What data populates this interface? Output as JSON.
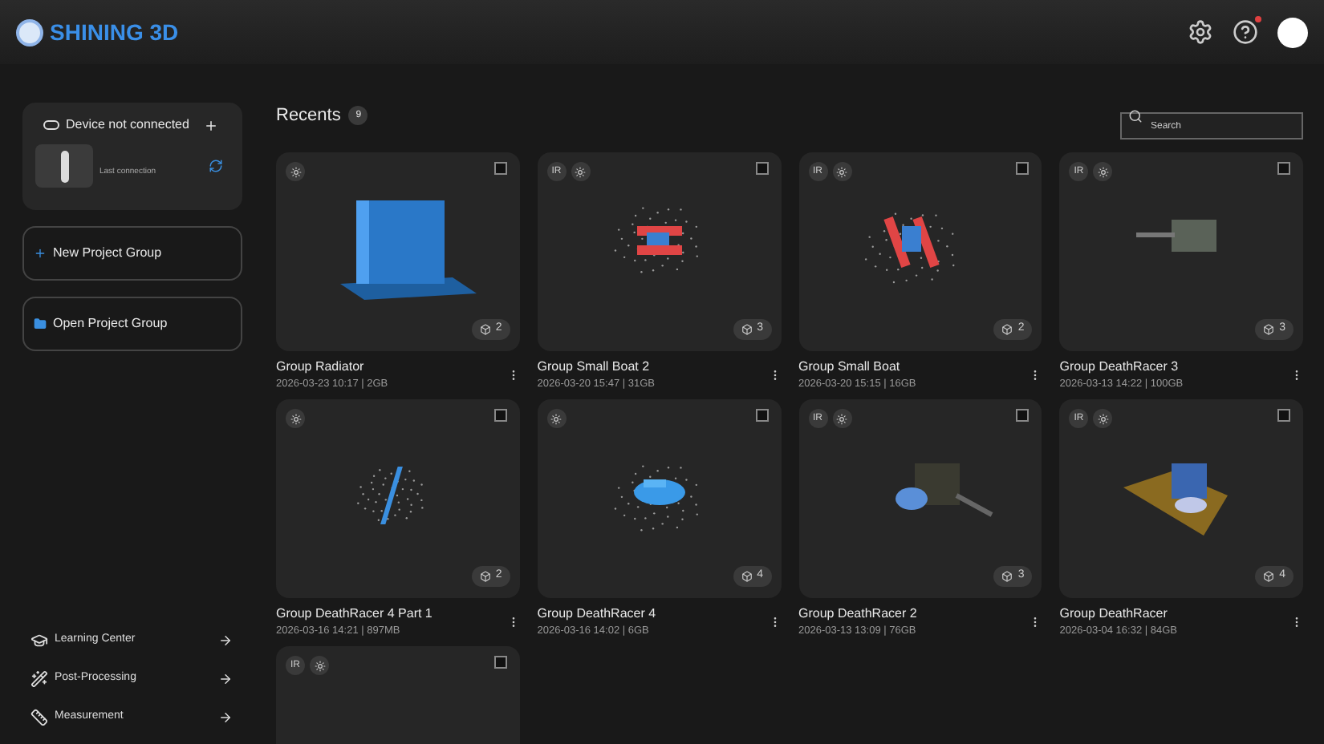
{
  "header": {
    "brand": "SHINING 3D",
    "notification": true
  },
  "device": {
    "status": "Device not connected",
    "last_connection": "Last connection"
  },
  "actions": [
    {
      "label": "New Project Group"
    },
    {
      "label": "Open Project Group"
    }
  ],
  "links": [
    {
      "label": "Learning Center",
      "kind": "learning"
    },
    {
      "label": "Post-Processing",
      "kind": "post"
    },
    {
      "label": "Measurement",
      "kind": "measure"
    }
  ],
  "recents": {
    "title": "Recents",
    "count": "9",
    "search": {
      "placeholder": "Search"
    }
  },
  "projects": [
    {
      "name": "Group Radiator",
      "meta": "2026-03-23 10:17 | 2GB",
      "scans": "2",
      "selected": false
    },
    {
      "name": "Group Small Boat 2",
      "meta": "2026-03-20 15:47 | 31GB",
      "mode": "IR",
      "scans": "3",
      "selected": false
    },
    {
      "name": "Group Small Boat",
      "meta": "2026-03-20 15:15 | 16GB",
      "mode": "IR",
      "scans": "2",
      "selected": false
    },
    {
      "name": "Group DeathRacer 3",
      "meta": "2026-03-13 14:22 | 100GB",
      "mode": "IR",
      "scans": "3",
      "selected": false
    },
    {
      "name": "Group DeathRacer 4 Part 1",
      "meta": "2026-03-16 14:21 | 897MB",
      "scans": "2",
      "selected": false
    },
    {
      "name": "Group DeathRacer 4",
      "meta": "2026-03-16 14:02 | 6GB",
      "scans": "4",
      "selected": false
    },
    {
      "name": "Group DeathRacer 2",
      "meta": "2026-03-13 13:09 | 76GB",
      "mode": "IR",
      "scans": "3",
      "selected": false
    },
    {
      "name": "Group DeathRacer",
      "meta": "2026-03-04 16:32 | 84GB",
      "mode": "IR",
      "scans": "4",
      "selected": false
    },
    {
      "mode": "IR",
      "selected": false
    }
  ]
}
